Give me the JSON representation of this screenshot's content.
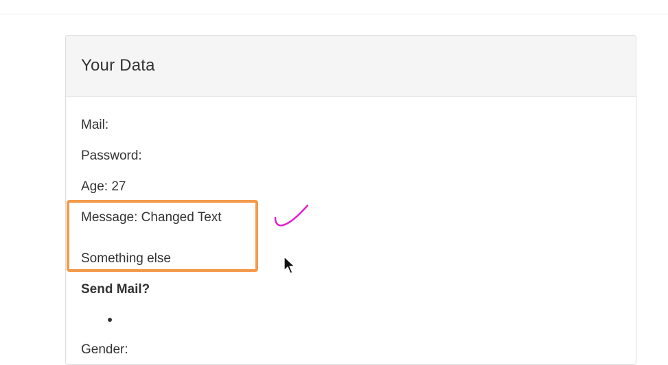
{
  "panel": {
    "title": "Your Data"
  },
  "fields": {
    "mail_label": "Mail:",
    "password_label": "Password:",
    "age_text": "Age: 27",
    "message_text": "Message: Changed Text",
    "message_extra": "Something else",
    "send_mail_label": "Send Mail?",
    "gender_label": "Gender:"
  },
  "annotations": {
    "highlight_color": "#f39a4b",
    "check_color": "#e020d0"
  }
}
